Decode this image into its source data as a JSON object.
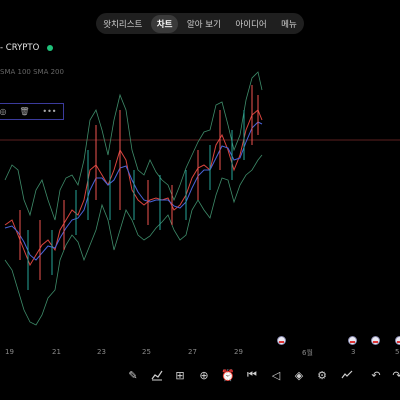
{
  "tabs": [
    "왓치리스트",
    "차트",
    "알아 보기",
    "아이디어",
    "메뉴"
  ],
  "active_tab": "차트",
  "symbol": {
    "label": "- CRYPTO"
  },
  "indicators": {
    "label": "SMA 100 SMA 200"
  },
  "drawing_tools": {
    "eye_icon": "eye-icon",
    "trash_icon": "trash-icon",
    "more_icon": "more-icon",
    "more_label": "•••"
  },
  "x_axis": {
    "labels": [
      "19",
      "21",
      "23",
      "25",
      "27",
      "29",
      "6월",
      "3",
      "5"
    ]
  },
  "colors": {
    "background": "#000000",
    "band": "#3e8c6a",
    "sma_red": "#d9443e",
    "sma_blue": "#4a63d8",
    "price_line": "#c9403a",
    "candle_up": "#26a69a",
    "candle_down": "#ef5350"
  },
  "bottom_toolbar": [
    "pencil-icon",
    "chart-line-icon",
    "grid-icon",
    "add-icon",
    "alarm-icon",
    "replay-icon",
    "layers-icon",
    "settings-sliders-icon",
    "trend-icon",
    "undo-icon",
    "redo-icon"
  ]
}
